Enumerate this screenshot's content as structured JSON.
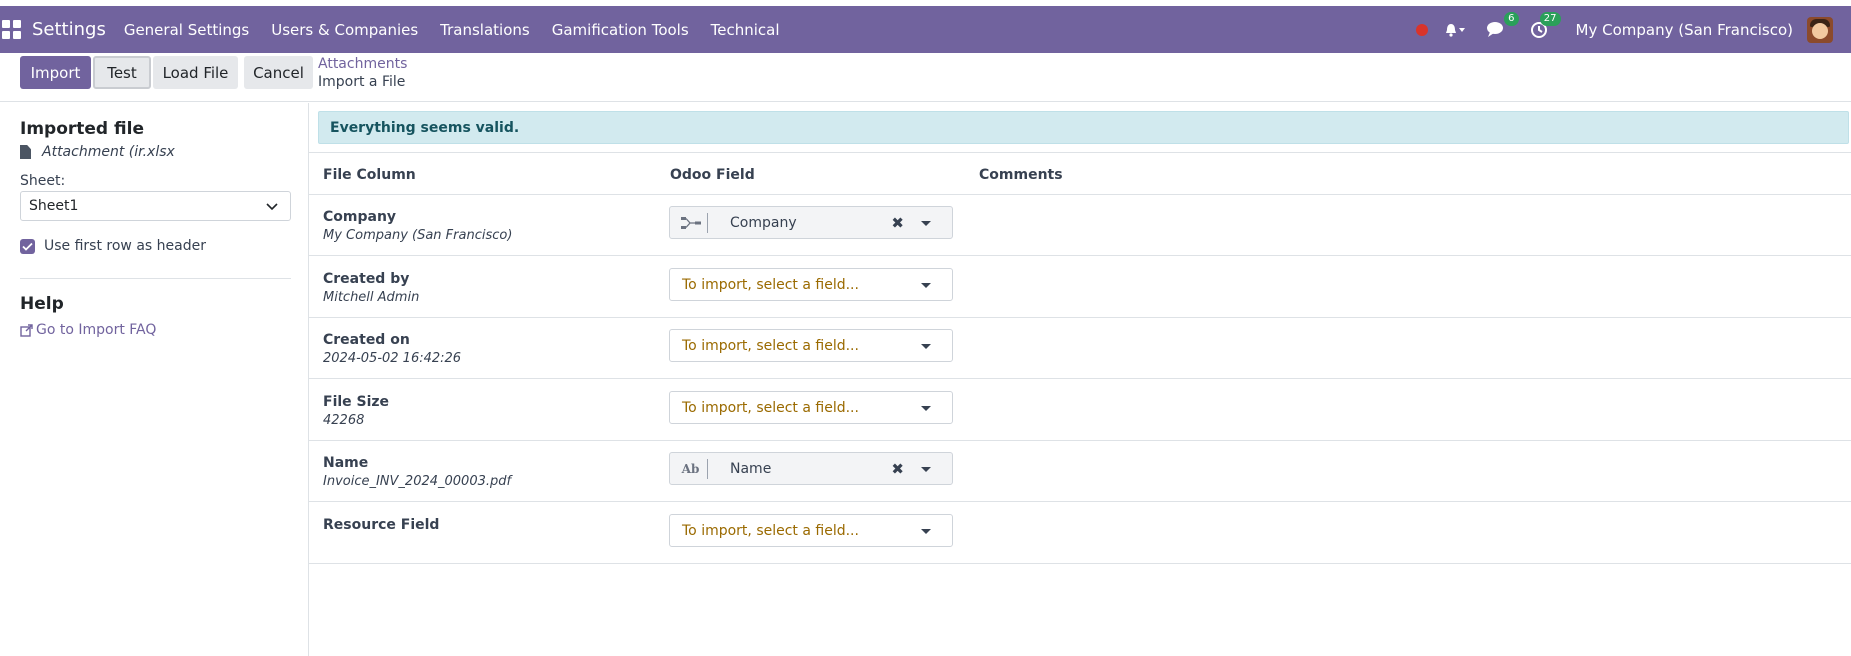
{
  "topbar": {
    "app_name": "Settings",
    "menu": [
      "General Settings",
      "Users & Companies",
      "Translations",
      "Gamification Tools",
      "Technical"
    ],
    "messages_count": "6",
    "activities_count": "27",
    "company": "My Company (San Francisco)",
    "bg_color": "#71639e"
  },
  "controls": {
    "import_label": "Import",
    "test_label": "Test",
    "load_file_label": "Load File",
    "cancel_label": "Cancel"
  },
  "breadcrumb": {
    "parent": "Attachments",
    "current": "Import a File"
  },
  "sidebar": {
    "imported_title": "Imported file",
    "file_name": "Attachment (ir.xlsx",
    "sheet_label": "Sheet:",
    "sheet_value": "Sheet1",
    "header_checkbox_label": "Use first row as header",
    "header_checked": true,
    "help_title": "Help",
    "faq_link": "Go to Import FAQ"
  },
  "main": {
    "alert": "Everything seems valid.",
    "columns": {
      "file_column": "File Column",
      "odoo_field": "Odoo Field",
      "comments": "Comments"
    },
    "rows": [
      {
        "name": "Company",
        "sample": "My Company (San Francisco)",
        "field": "Company",
        "field_icon": "relation-icon",
        "set": true
      },
      {
        "name": "Created by",
        "sample": "Mitchell Admin",
        "field": "To import, select a field...",
        "set": false
      },
      {
        "name": "Created on",
        "sample": "2024-05-02 16:42:26",
        "field": "To import, select a field...",
        "set": false
      },
      {
        "name": "File Size",
        "sample": "42268",
        "field": "To import, select a field...",
        "set": false
      },
      {
        "name": "Name",
        "sample": "Invoice_INV_2024_00003.pdf",
        "field": "Name",
        "field_icon": "text-icon",
        "field_icon_text": "Ab",
        "set": true
      },
      {
        "name": "Resource Field",
        "sample": "",
        "field": "To import, select a field...",
        "set": false
      }
    ]
  }
}
